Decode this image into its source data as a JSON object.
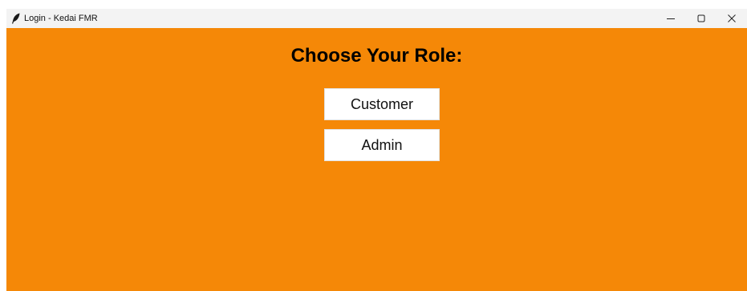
{
  "window": {
    "title": "Login - Kedai FMR",
    "icon": "feather-icon",
    "controls": [
      "minimize-icon",
      "maximize-icon",
      "close-icon"
    ],
    "background_color": "#f58807"
  },
  "main": {
    "heading": "Choose Your Role:",
    "buttons": [
      {
        "label": "Customer"
      },
      {
        "label": "Admin"
      }
    ]
  }
}
